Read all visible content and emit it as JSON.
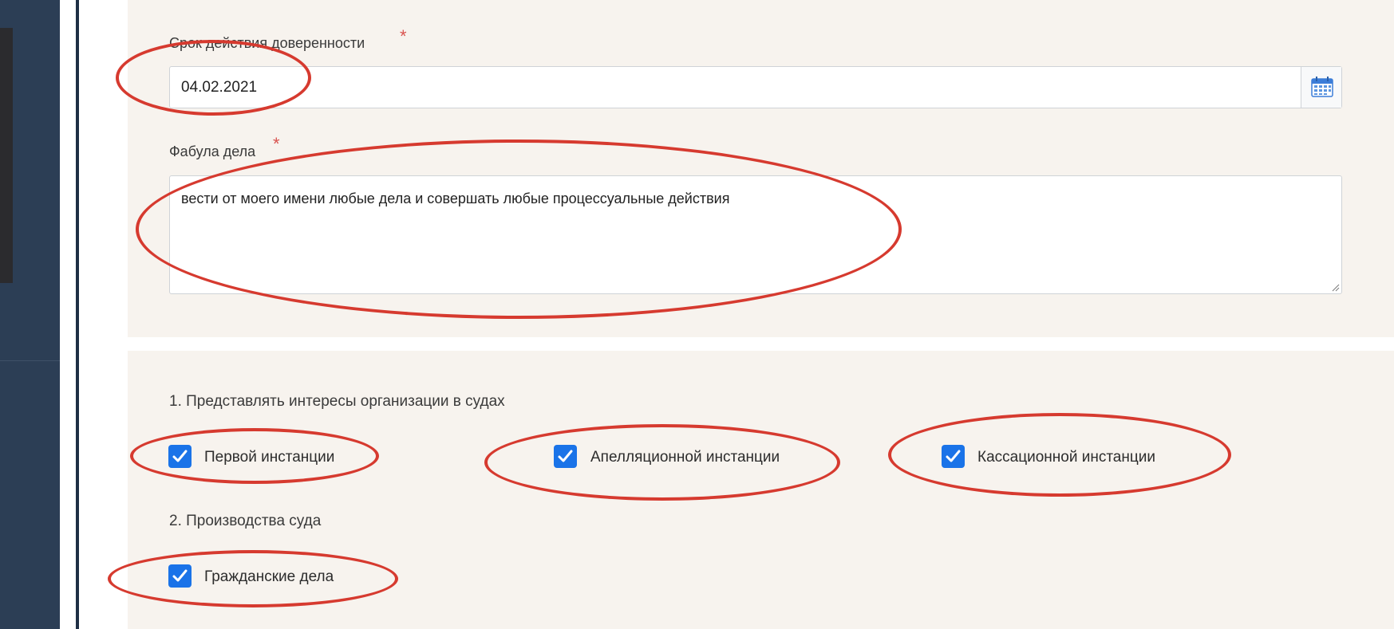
{
  "form": {
    "validity": {
      "label": "Срок действия доверенности",
      "required_mark": "*",
      "value": "04.02.2021",
      "calendar_icon": "calendar-icon"
    },
    "case_summary": {
      "label": "Фабула дела",
      "required_mark": "*",
      "value": "вести от моего имени любые дела и совершать любые процессуальные действия"
    }
  },
  "powers": {
    "section1": {
      "title": "1. Представлять интересы организации в судах",
      "options": [
        {
          "label": "Первой инстанции",
          "checked": true
        },
        {
          "label": "Апелляционной инстанции",
          "checked": true
        },
        {
          "label": "Кассационной инстанции",
          "checked": true
        }
      ]
    },
    "section2": {
      "title": "2. Производства суда",
      "options": [
        {
          "label": "Гражданские дела",
          "checked": true
        }
      ]
    }
  },
  "colors": {
    "annotation": "#d63a2f",
    "checkbox": "#1a73e8",
    "panel_bg": "#f7f3ee",
    "sidebar": "#2c3e55"
  }
}
